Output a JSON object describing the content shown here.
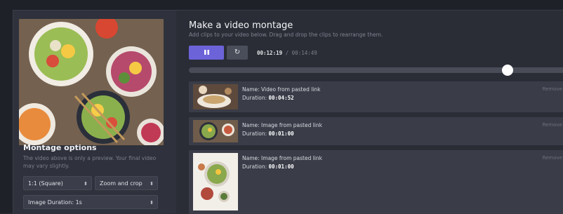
{
  "montage_options": {
    "title": "Montage options",
    "note": "The video above is only a preview. Your final video may vary slightly.",
    "aspect_ratio": "1:1 (Square)",
    "fit_mode": "Zoom and crop",
    "image_duration": "Image Duration: 1s"
  },
  "editor": {
    "title": "Make a video montage",
    "subtitle": "Add clips to your video below. Drag and drop the clips to rearrange them.",
    "pause_icon": "pause-icon",
    "restart_icon": "restart-icon",
    "current_time": "00:12:19",
    "time_separator": "/",
    "total_time": "00:14:49",
    "progress_fraction": 0.84
  },
  "clips": [
    {
      "name_label": "Name:",
      "name": "Video from pasted link",
      "duration_label": "Duration:",
      "duration": "00:04:52",
      "remove": "Remove"
    },
    {
      "name_label": "Name:",
      "name": "Image from pasted link",
      "duration_label": "Duration:",
      "duration": "00:01:00",
      "remove": "Remove"
    },
    {
      "name_label": "Name:",
      "name": "Image from pasted link",
      "duration_label": "Duration:",
      "duration": "00:01:00",
      "remove": "Remove"
    }
  ],
  "colors": {
    "accent": "#6c63d9",
    "panel": "#3a3d48",
    "background": "#2a2d36"
  }
}
